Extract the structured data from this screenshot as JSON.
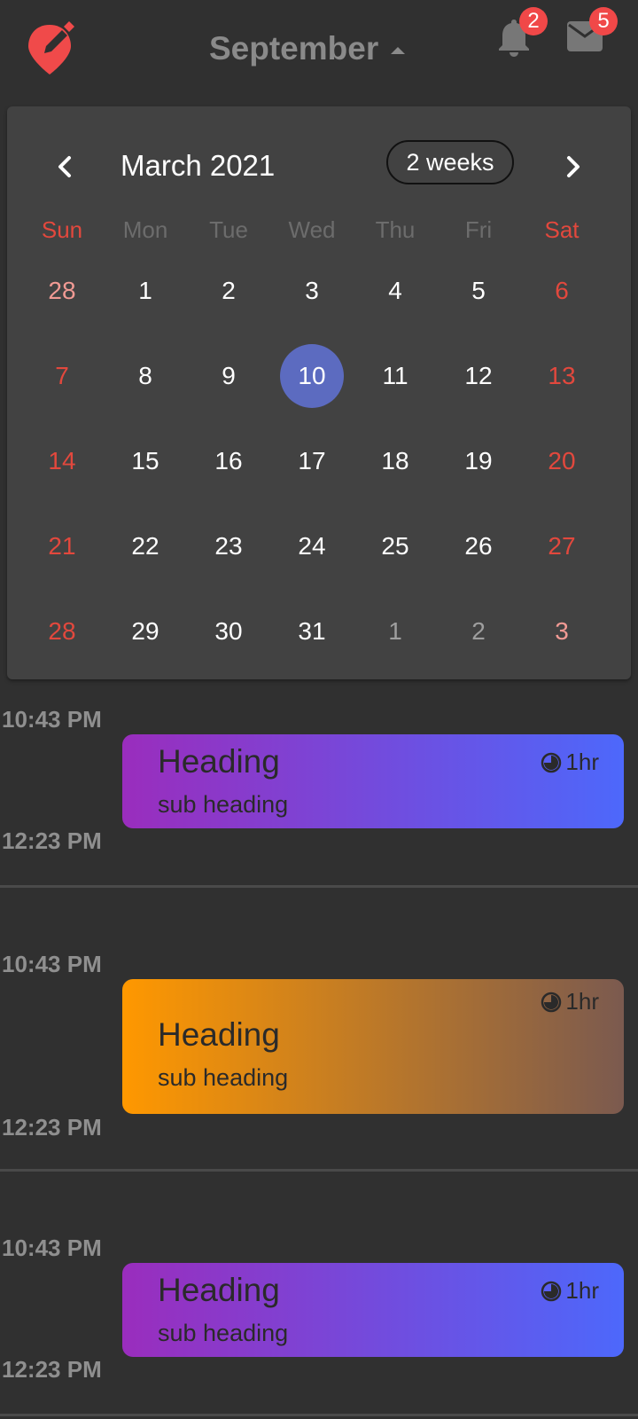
{
  "header": {
    "month_label": "September",
    "notification_count": "2",
    "mail_count": "5"
  },
  "calendar": {
    "title": "March 2021",
    "format_button": "2 weeks",
    "weekdays": [
      "Sun",
      "Mon",
      "Tue",
      "Wed",
      "Thu",
      "Fri",
      "Sat"
    ],
    "selected_day": "10",
    "weeks": [
      [
        "28",
        "1",
        "2",
        "3",
        "4",
        "5",
        "6"
      ],
      [
        "7",
        "8",
        "9",
        "10",
        "11",
        "12",
        "13"
      ],
      [
        "14",
        "15",
        "16",
        "17",
        "18",
        "19",
        "20"
      ],
      [
        "21",
        "22",
        "23",
        "24",
        "25",
        "26",
        "27"
      ],
      [
        "28",
        "29",
        "30",
        "31",
        "1",
        "2",
        "3"
      ]
    ],
    "colors": {
      "selected": "#5c6bc0",
      "weekend": "#e2483d"
    }
  },
  "events": [
    {
      "start": "10:43 PM",
      "end": "12:23 PM",
      "heading": "Heading",
      "sub": "sub heading",
      "duration": "1hr",
      "gradient": [
        "#9a2dbd",
        "#4d68fb"
      ]
    },
    {
      "start": "10:43 PM",
      "end": "12:23 PM",
      "heading": "Heading",
      "sub": "sub heading",
      "duration": "1hr",
      "gradient": [
        "#ff9800",
        "#7b5a4f"
      ]
    },
    {
      "start": "10:43 PM",
      "end": "12:23 PM",
      "heading": "Heading",
      "sub": "sub heading",
      "duration": "1hr",
      "gradient": [
        "#9a2dbd",
        "#4d68fb"
      ]
    }
  ],
  "icons": {
    "logo": "map-pin-edit-icon",
    "notification": "bell-icon",
    "mail": "mail-icon",
    "prev": "chevron-left-icon",
    "next": "chevron-right-icon",
    "duration": "clock-icon"
  }
}
